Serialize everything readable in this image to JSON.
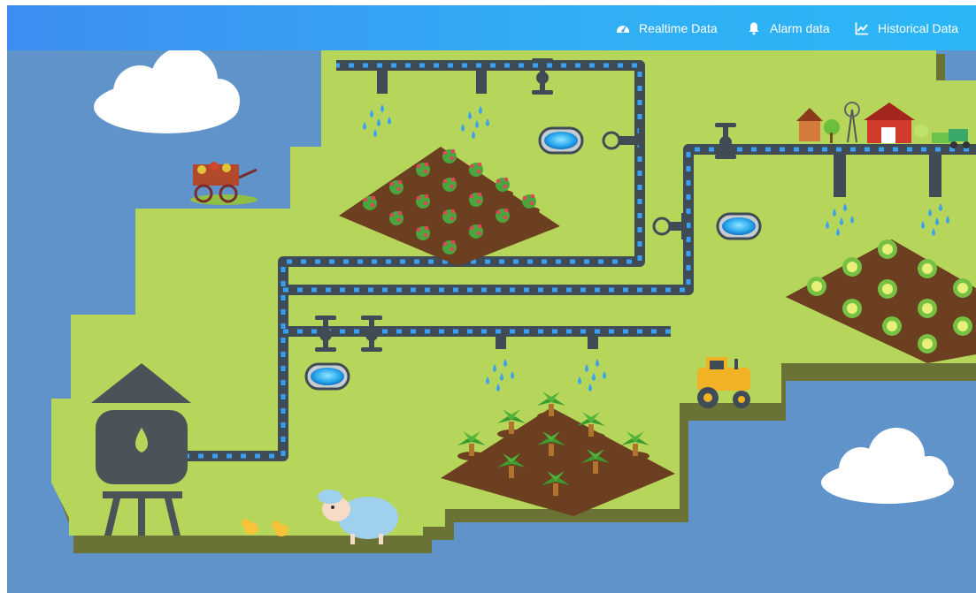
{
  "nav": {
    "items": [
      {
        "label": "Realtime Data",
        "icon": "dashboard-icon"
      },
      {
        "label": "Alarm data",
        "icon": "bell-icon"
      },
      {
        "label": "Historical Data",
        "icon": "line-chart-icon"
      }
    ]
  },
  "colors": {
    "header_start": "#3d8df0",
    "header_end": "#2bb6f8",
    "background": "#6193cb",
    "land": "#b5d65a",
    "land_shadow": "#6a7335",
    "pipe": "#3f4b55",
    "pipe_dot": "#3aa0f2"
  }
}
